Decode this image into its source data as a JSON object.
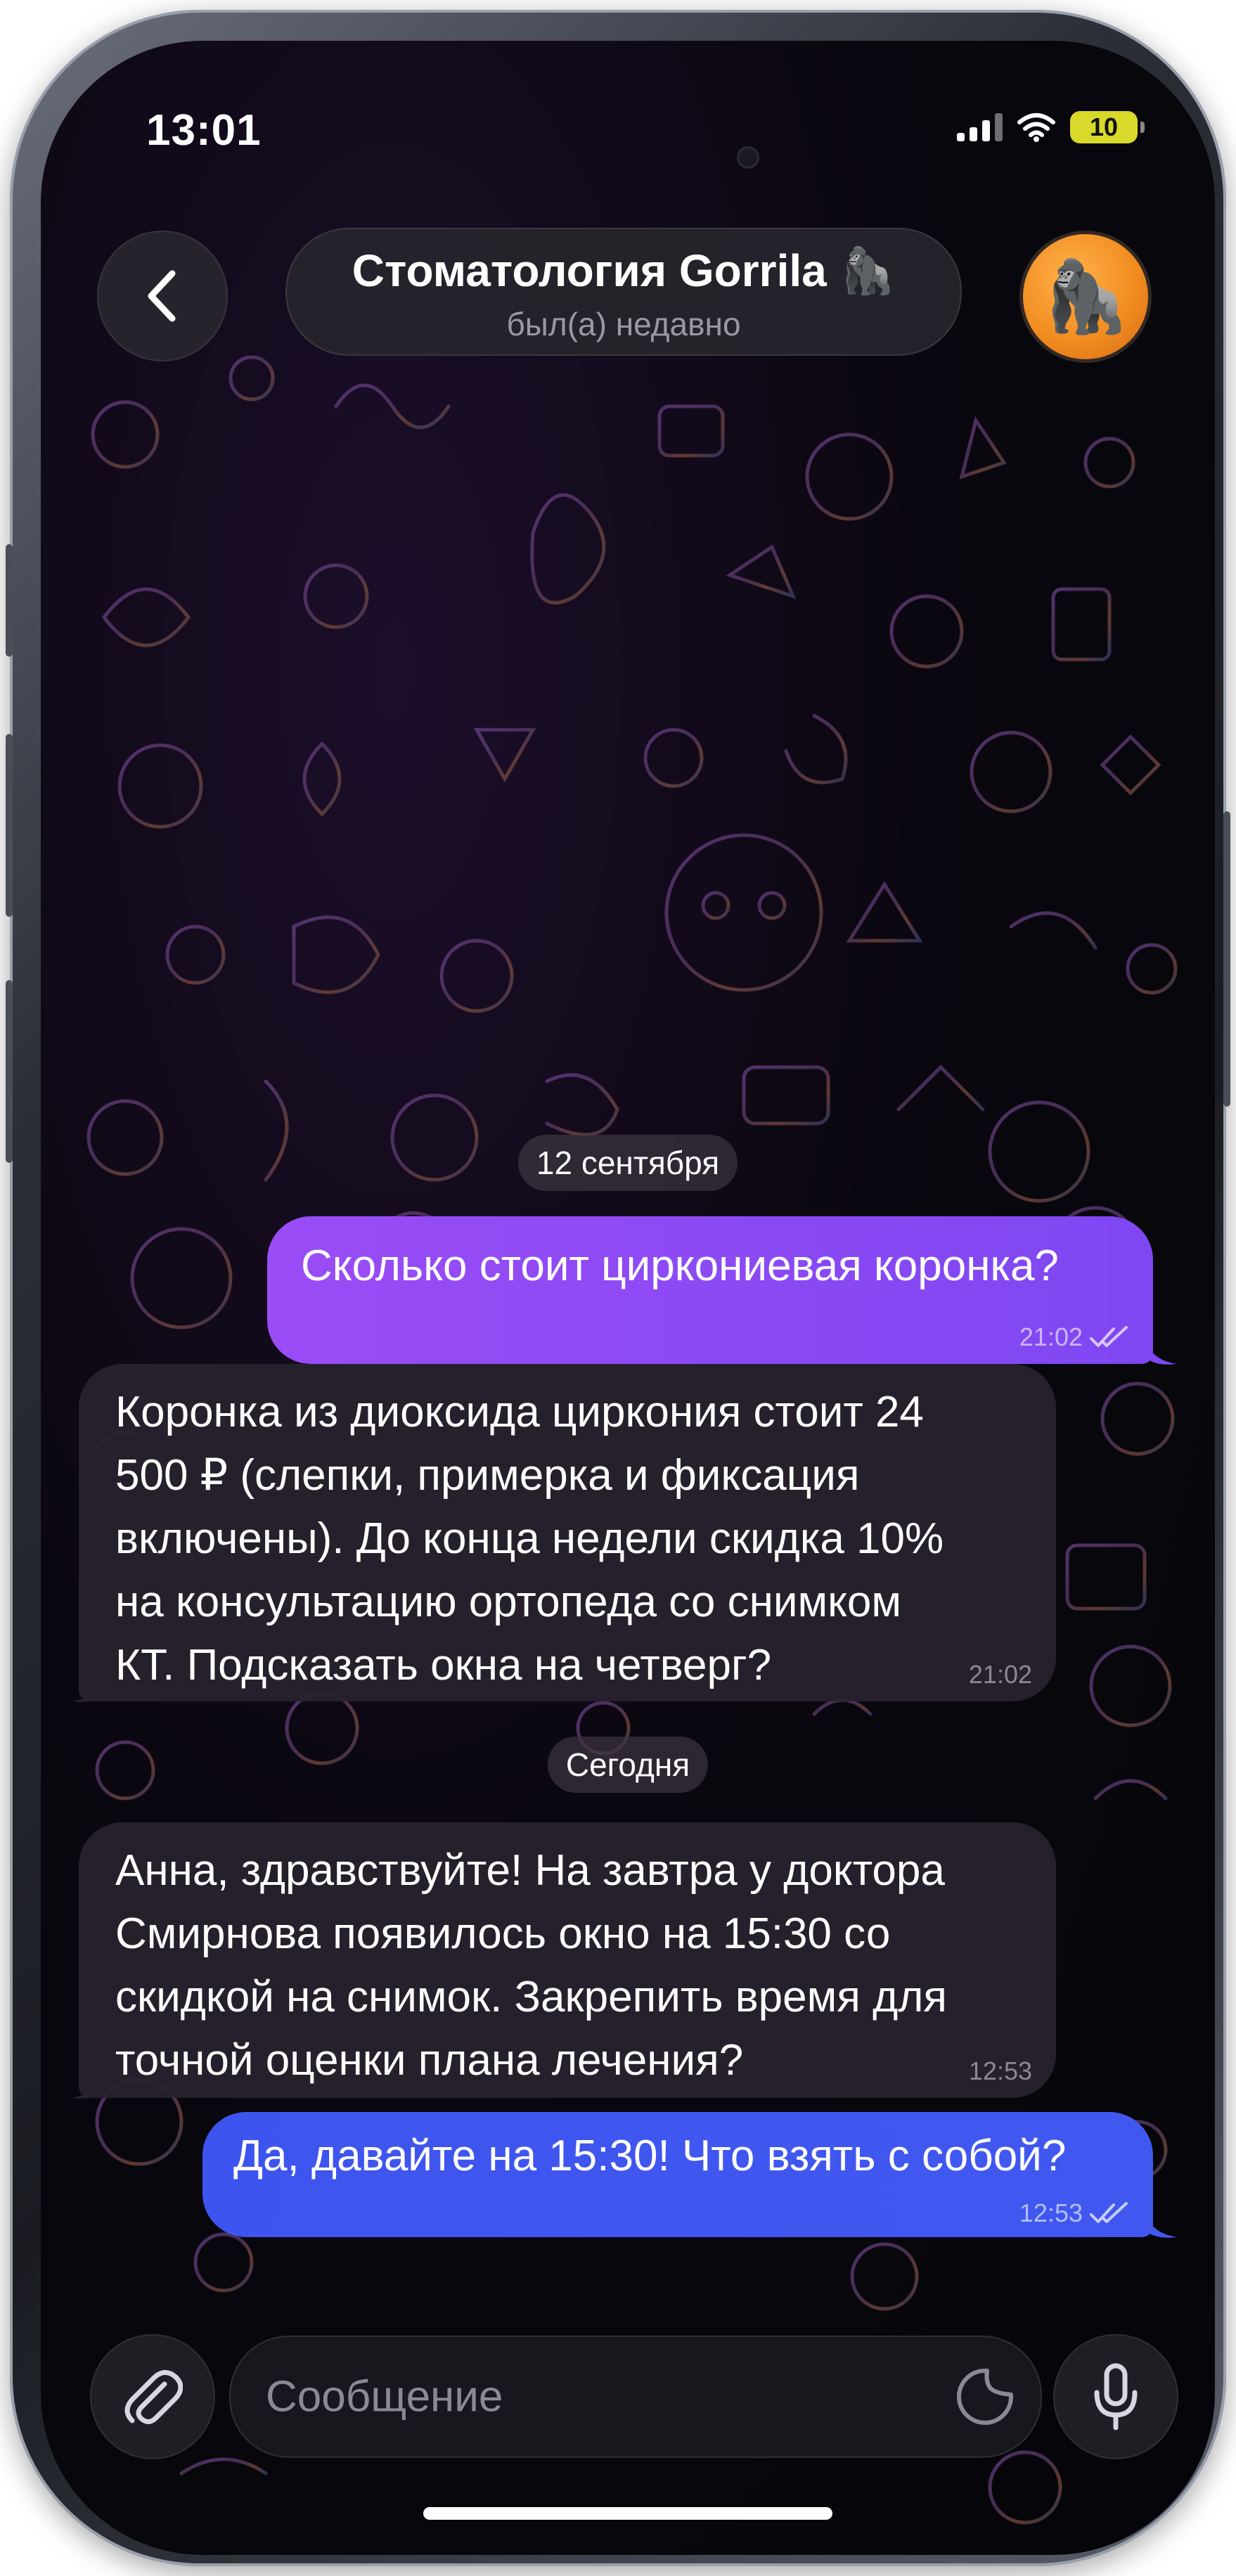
{
  "status_bar": {
    "time": "13:01",
    "battery": "10"
  },
  "header": {
    "back_icon": "chevron-left-icon",
    "chat_name": "Стоматология Gorrila 🦍",
    "chat_status": "был(а) недавно",
    "avatar_emoji": "🦍"
  },
  "messages": [
    {
      "type": "date",
      "text": "12 сентября"
    },
    {
      "type": "outgoing",
      "text": "Сколько стоит циркониевая коронка?",
      "time": "21:02",
      "read": true
    },
    {
      "type": "incoming",
      "lines": [
        "Коронка из диоксида циркония стоит 24",
        "500 ₽ (слепки, примерка и фиксация",
        "включены). До конца недели скидка 10%",
        "на консультацию ортопеда со снимком",
        "КТ. Подсказать окна на четверг?"
      ],
      "time": "21:02"
    },
    {
      "type": "date",
      "text": "Сегодня"
    },
    {
      "type": "incoming",
      "lines": [
        "Анна, здравствуйте! На завтра у доктора",
        "Смирнова появилось окно на 15:30 со",
        "скидкой на снимок. Закрепить время для",
        "точной оценки плана лечения?"
      ],
      "time": "12:53"
    },
    {
      "type": "outgoing",
      "text": "Да, давайте на 15:30! Что взять с собой?",
      "time": "12:53",
      "read": true
    }
  ],
  "composer": {
    "placeholder": "Сообщение",
    "attach_icon": "paperclip-icon",
    "sticker_icon": "sticker-icon",
    "mic_icon": "microphone-icon"
  },
  "colors": {
    "outgoing_bubble_1": "#8a4af4",
    "outgoing_bubble_2": "#3f56ef",
    "incoming_bubble": "#28222e",
    "battery": "#d8d92a",
    "avatar": "#f08a1e"
  }
}
